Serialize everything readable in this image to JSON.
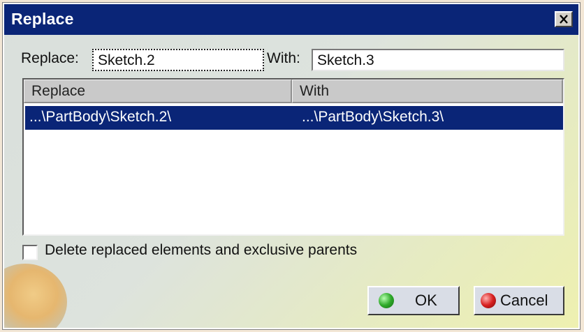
{
  "window": {
    "title": "Replace",
    "close_icon": "close-icon"
  },
  "fields": {
    "replace_label": "Replace:",
    "replace_value": "Sketch.2",
    "with_label": "With:",
    "with_value": "Sketch.3"
  },
  "list": {
    "columns": [
      "Replace",
      "With"
    ],
    "rows": [
      {
        "replace": "...\\PartBody\\Sketch.2\\",
        "with": "...\\PartBody\\Sketch.3\\"
      }
    ]
  },
  "options": {
    "delete_label": "Delete replaced elements and exclusive parents",
    "delete_checked": false
  },
  "buttons": {
    "ok_label": "OK",
    "cancel_label": "Cancel"
  },
  "colors": {
    "titlebar": "#0a2577",
    "selection": "#0a2577",
    "ok_indicator": "#2faa2a",
    "cancel_indicator": "#d81f1f"
  }
}
